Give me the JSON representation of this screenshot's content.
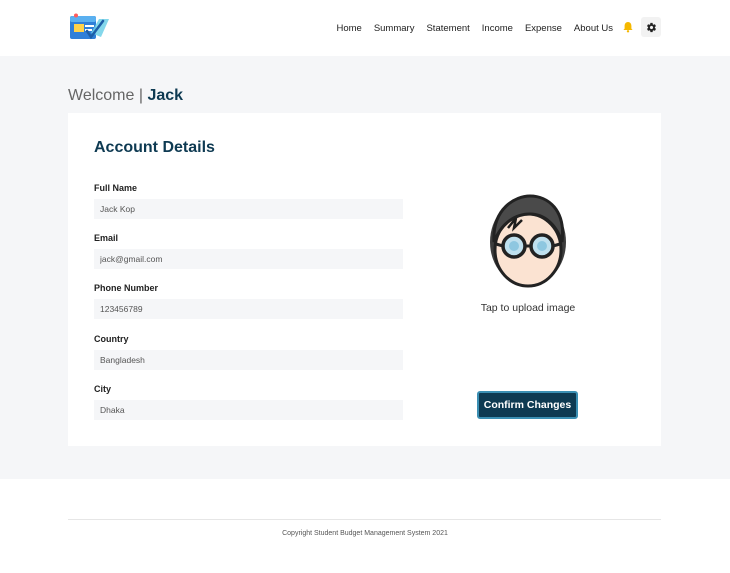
{
  "nav": {
    "links": [
      "Home",
      "Summary",
      "Statement",
      "Income",
      "Expense",
      "About Us"
    ]
  },
  "welcome": {
    "prefix": "Welcome | ",
    "username": "Jack"
  },
  "account": {
    "title": "Account Details",
    "fields": [
      {
        "label": "Full Name",
        "value": "Jack Kop"
      },
      {
        "label": "Email",
        "value": "jack@gmail.com"
      },
      {
        "label": "Phone Number",
        "value": "123456789"
      },
      {
        "label": "Country",
        "value": "Bangladesh"
      },
      {
        "label": "City",
        "value": "Dhaka"
      }
    ],
    "upload_text": "Tap to upload image",
    "confirm_label": "Confirm Changes"
  },
  "footer": {
    "copyright": "Copyright Student Budget Management System 2021"
  },
  "colors": {
    "primary": "#0e3a52",
    "accent_border": "#3b8fb3",
    "bell": "#f5b800",
    "background": "#f5f6f8"
  },
  "icons": {
    "logo": "wallet-logo-icon",
    "notification": "bell-icon",
    "settings": "gear-icon",
    "avatar": "avatar-glasses-icon"
  }
}
